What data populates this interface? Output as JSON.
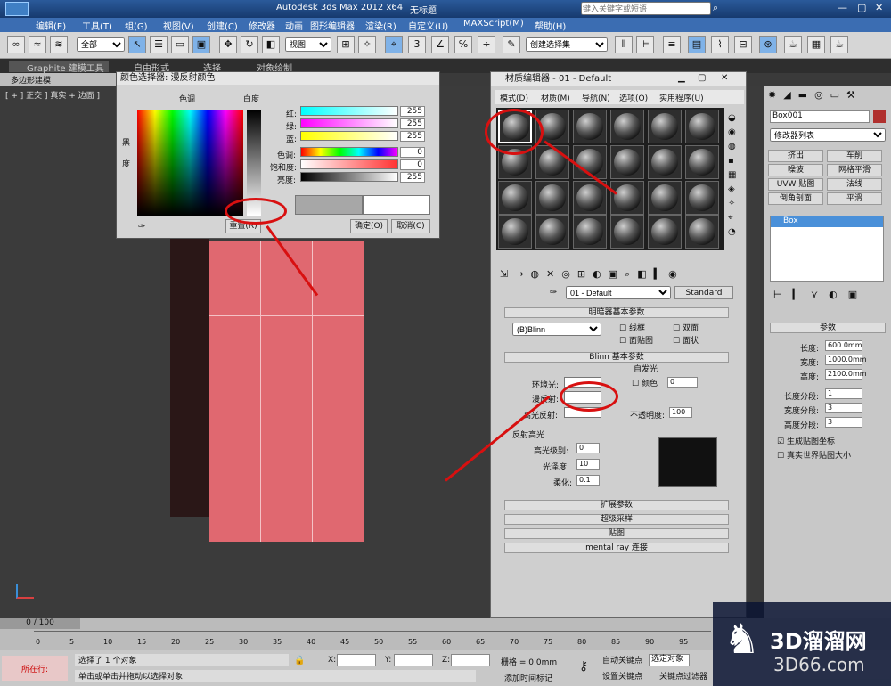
{
  "app": {
    "title": "Autodesk 3ds Max  2012  x64",
    "file": "无标题",
    "search_placeholder": "键入关键字或短语"
  },
  "menu": [
    "编辑(E)",
    "工具(T)",
    "组(G)",
    "视图(V)",
    "创建(C)",
    "修改器",
    "动画",
    "图形编辑器",
    "渲染(R)",
    "自定义(U)",
    "MAXScript(M)",
    "帮助(H)"
  ],
  "toolbar": {
    "selection_filter": "全部",
    "view": "视图",
    "named_sel": "创建选择集"
  },
  "ribbon": {
    "tabs": [
      "Graphite 建模工具",
      "自由形式",
      "选择",
      "对象绘制"
    ],
    "sub": "多边形建模"
  },
  "viewport": {
    "label": "[ + ] 正交 ] 真实 + 边面 ]"
  },
  "color_picker": {
    "title": "颜色选择器: 漫反射颜色",
    "hue": "色调",
    "white": "白度",
    "black": "黑",
    "degree": "度",
    "channels": [
      {
        "label": "红:",
        "value": "255"
      },
      {
        "label": "绿:",
        "value": "255"
      },
      {
        "label": "蓝:",
        "value": "255"
      },
      {
        "label": "色调:",
        "value": "0"
      },
      {
        "label": "饱和度:",
        "value": "0"
      },
      {
        "label": "亮度:",
        "value": "255"
      }
    ],
    "reset": "重置(R)",
    "ok": "确定(O)",
    "cancel": "取消(C)"
  },
  "material_editor": {
    "title": "材质编辑器 - 01 - Default",
    "menu": [
      "模式(D)",
      "材质(M)",
      "导航(N)",
      "选项(O)",
      "实用程序(U)"
    ],
    "material_name": "01 - Default",
    "material_type": "Standard",
    "shader_section": "明暗器基本参数",
    "shader": "(B)Blinn",
    "wire": "线框",
    "two_sided": "双面",
    "face_map": "面贴图",
    "faceted": "面状",
    "blinn_section": "Blinn 基本参数",
    "self_illum": "自发光",
    "color": "颜色",
    "self_illum_value": "0",
    "ambient": "环境光:",
    "diffuse": "漫反射:",
    "specular": "高光反射:",
    "opacity": "不透明度:",
    "opacity_value": "100",
    "spec_hl": "反射高光",
    "spec_level": "高光级别:",
    "spec_level_value": "0",
    "glossiness": "光泽度:",
    "glossiness_value": "10",
    "soften": "柔化:",
    "soften_value": "0.1",
    "rollouts": [
      "扩展参数",
      "超级采样",
      "贴图",
      "mental ray 连接"
    ]
  },
  "cmd_panel": {
    "object_name": "Box001",
    "modifier_list": "修改器列表",
    "buttons": [
      "挤出",
      "车削",
      "噪波",
      "网格平滑",
      "UVW 贴图",
      "法线",
      "倒角剖面",
      "平滑"
    ],
    "stack_item": "Box",
    "params_title": "参数",
    "length_label": "长度:",
    "length": "600.0mm",
    "width_label": "宽度:",
    "width": "1000.0mm",
    "height_label": "高度:",
    "height": "2100.0mm",
    "lseg_label": "长度分段:",
    "lseg": "1",
    "wseg_label": "宽度分段:",
    "wseg": "3",
    "hseg_label": "高度分段:",
    "hseg": "3",
    "gen_map": "生成贴图坐标",
    "real_world": "真实世界贴图大小"
  },
  "timeline": {
    "frame": "0 / 100",
    "ticks": [
      "0",
      "5",
      "10",
      "15",
      "20",
      "25",
      "30",
      "35",
      "40",
      "45",
      "50",
      "55",
      "60",
      "65",
      "70",
      "75",
      "80",
      "85",
      "90",
      "95"
    ]
  },
  "status": {
    "msg1": "选择了 1 个对象",
    "msg2": "单击或单击并拖动以选择对象",
    "running": "所在行:",
    "x": "X:",
    "y": "Y:",
    "z": "Z:",
    "grid": "栅格 = 0.0mm",
    "auto_key": "自动关键点",
    "set_key": "设置关键点",
    "sel_obj": "选定对象",
    "add_tag": "添加时间标记",
    "key_filter": "关键点过滤器"
  },
  "watermark": {
    "cn": "3D溜溜网",
    "url": "3D66.com"
  }
}
